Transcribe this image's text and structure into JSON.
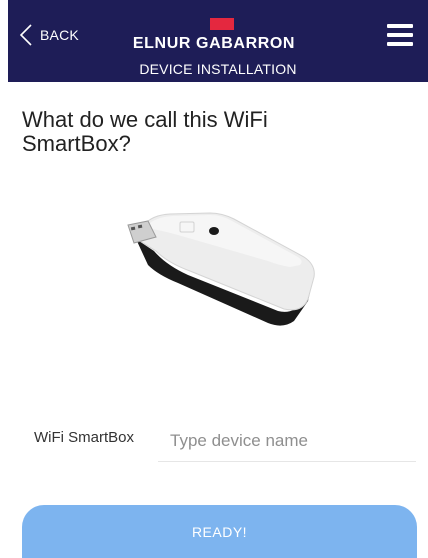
{
  "header": {
    "back_label": "BACK",
    "brand": "ELNUR GABARRON",
    "subtitle": "DEVICE INSTALLATION",
    "brand_color": "#e4283f",
    "bg_color": "#1e1d57",
    "back_icon": "chevron-left-icon",
    "menu_icon": "hamburger-menu-icon"
  },
  "main": {
    "question": "What do we call this WiFi SmartBox?",
    "device_image": "wifi-smartbox-image"
  },
  "form": {
    "field_label": "WiFi SmartBox",
    "name_placeholder": "Type device name",
    "name_value": ""
  },
  "actions": {
    "ready_label": "READY!",
    "button_color": "#7db4ef"
  }
}
